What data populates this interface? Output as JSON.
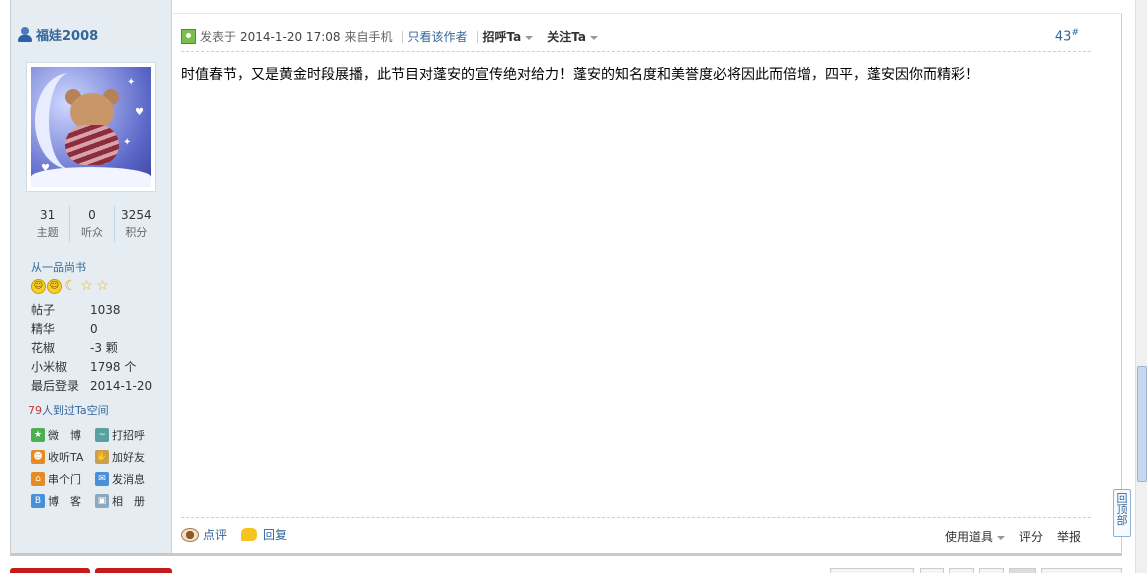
{
  "user": {
    "name": "福娃2008",
    "stats": [
      {
        "value": "31",
        "label": "主题"
      },
      {
        "value": "0",
        "label": "听众"
      },
      {
        "value": "3254",
        "label": "积分"
      }
    ],
    "rank": "从一品尚书",
    "medals": [
      "sun",
      "sun",
      "moon",
      "star",
      "star"
    ],
    "profile": [
      {
        "key": "帖子",
        "value": "1038"
      },
      {
        "key": "精华",
        "value": "0"
      },
      {
        "key": "花椒",
        "value": "-3 颗"
      },
      {
        "key": "小米椒",
        "value": "1798 个"
      },
      {
        "key": "最后登录",
        "value": "2014-1-20"
      }
    ],
    "visits_count": "79",
    "visits_text": "人到过Ta空间",
    "actions": [
      {
        "label": "微　博",
        "icon": "weibo-icon"
      },
      {
        "label": "打招呼",
        "icon": "wave-icon"
      },
      {
        "label": "收听TA",
        "icon": "follow-icon"
      },
      {
        "label": "加好友",
        "icon": "handshake-icon"
      },
      {
        "label": "串个门",
        "icon": "home-icon"
      },
      {
        "label": "发消息",
        "icon": "message-icon"
      },
      {
        "label": "博　客",
        "icon": "blog-icon"
      },
      {
        "label": "相　册",
        "icon": "album-icon"
      }
    ]
  },
  "post": {
    "posted_label": "发表于",
    "time": "2014-1-20 17:08",
    "source": "来自手机",
    "only_author": "只看该作者",
    "greet": "招呼Ta",
    "follow": "关注Ta",
    "floor": "43",
    "floor_mark": "#",
    "content": "时值春节，又是黄金时段展播，此节目对蓬安的宣传绝对给力！蓬安的知名度和美誉度必将因此而倍增，四平，蓬安因你而精彩！",
    "footer": {
      "rate": "点评",
      "reply": "回复",
      "tools": "使用道具",
      "score": "评分",
      "report": "举报"
    }
  },
  "back_to_top": "回顶部"
}
